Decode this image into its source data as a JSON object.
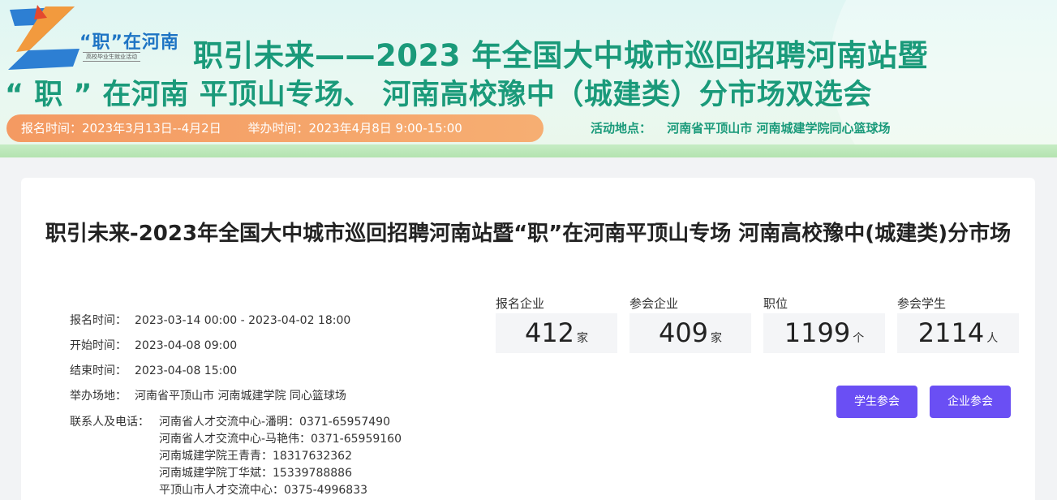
{
  "banner": {
    "logo_title": "“职”在河南",
    "logo_subtitle": "高校毕业生就业活动",
    "headline_line1": "职引未来——2023 年全国大中城市巡回招聘河南站暨",
    "headline_line2": "“ 职 ” 在河南  平顶山专场、 河南高校豫中（城建类）分市场双选会",
    "register_time": "报名时间：2023年3月13日--4月2日",
    "hold_time": "举办时间：2023年4月8日 9:00-15:00",
    "venue_label": "活动地点：",
    "venue_value": "河南省平顶山市  河南城建学院同心篮球场"
  },
  "event": {
    "title": "职引未来-2023年全国大中城市巡回招聘河南站暨“职”在河南平顶山专场 河南高校豫中(城建类)分市场",
    "info": [
      {
        "label": "报名时间：",
        "value": "2023-03-14 00:00 - 2023-04-02 18:00"
      },
      {
        "label": "开始时间：",
        "value": "2023-04-08 09:00"
      },
      {
        "label": "结束时间：",
        "value": "2023-04-08 15:00"
      },
      {
        "label": "举办场地：",
        "value": "河南省平顶山市 河南城建学院 同心篮球场"
      }
    ],
    "contact_label": "联系人及电话：",
    "contacts": [
      "河南省人才交流中心-潘明：0371-65957490",
      "河南省人才交流中心-马艳伟：0371-65959160",
      "河南城建学院王青青：18317632362",
      "河南城建学院丁华斌：15339788886",
      "平顶山市人才交流中心：0375-4996833"
    ],
    "stats": [
      {
        "label": "报名企业",
        "value": "412",
        "unit": "家"
      },
      {
        "label": "参会企业",
        "value": "409",
        "unit": "家"
      },
      {
        "label": "职位",
        "value": "1199",
        "unit": "个"
      },
      {
        "label": "参会学生",
        "value": "2114",
        "unit": "人"
      }
    ],
    "buttons": {
      "student": "学生参会",
      "company": "企业参会"
    }
  },
  "colors": {
    "brand_green": "#1a9a7a",
    "accent_orange": "#f49a62",
    "button_purple": "#6a4ff4"
  }
}
